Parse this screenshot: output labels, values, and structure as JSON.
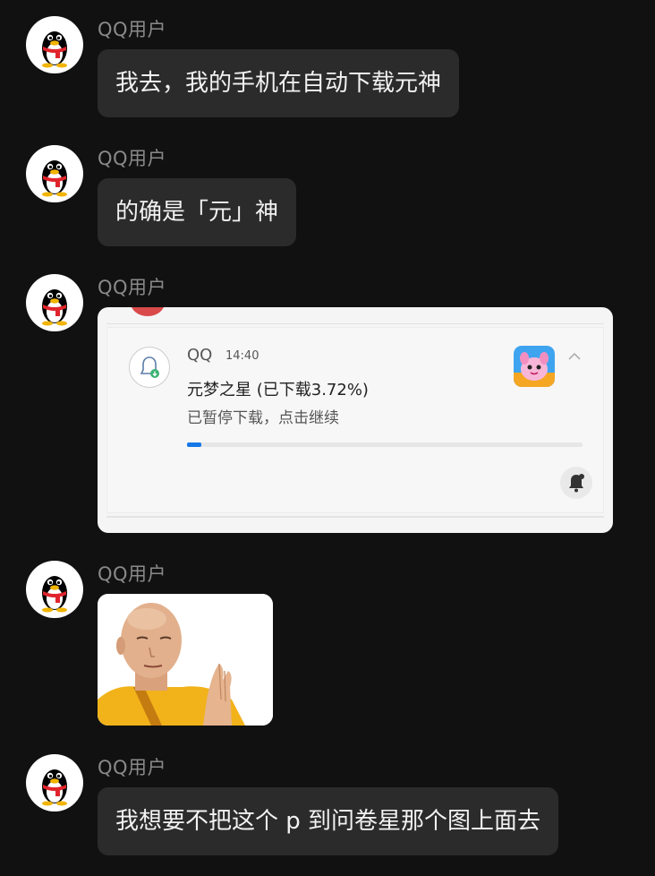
{
  "messages": [
    {
      "sender": "QQ用户",
      "text": "我去，我的手机在自动下载元神"
    },
    {
      "sender": "QQ用户",
      "text": "的确是「元」神"
    },
    {
      "sender": "QQ用户"
    },
    {
      "sender": "QQ用户"
    },
    {
      "sender": "QQ用户",
      "text": "我想要不把这个 p 到问卷星那个图上面去"
    }
  ],
  "notification": {
    "app": "QQ",
    "time": "14:40",
    "title": "元梦之星 (已下载3.72%)",
    "subtitle": "已暂停下载，点击继续",
    "progress_percent": 3.72,
    "icons": {
      "app": "qq-download-icon",
      "thumb": "game-thumbnail",
      "collapse": "chevron-up-icon",
      "bell": "bell-off-icon"
    }
  },
  "colors": {
    "background": "#111111",
    "bubble": "#2b2b2b",
    "sender": "#8a8a8a",
    "progress": "#1677e6"
  }
}
